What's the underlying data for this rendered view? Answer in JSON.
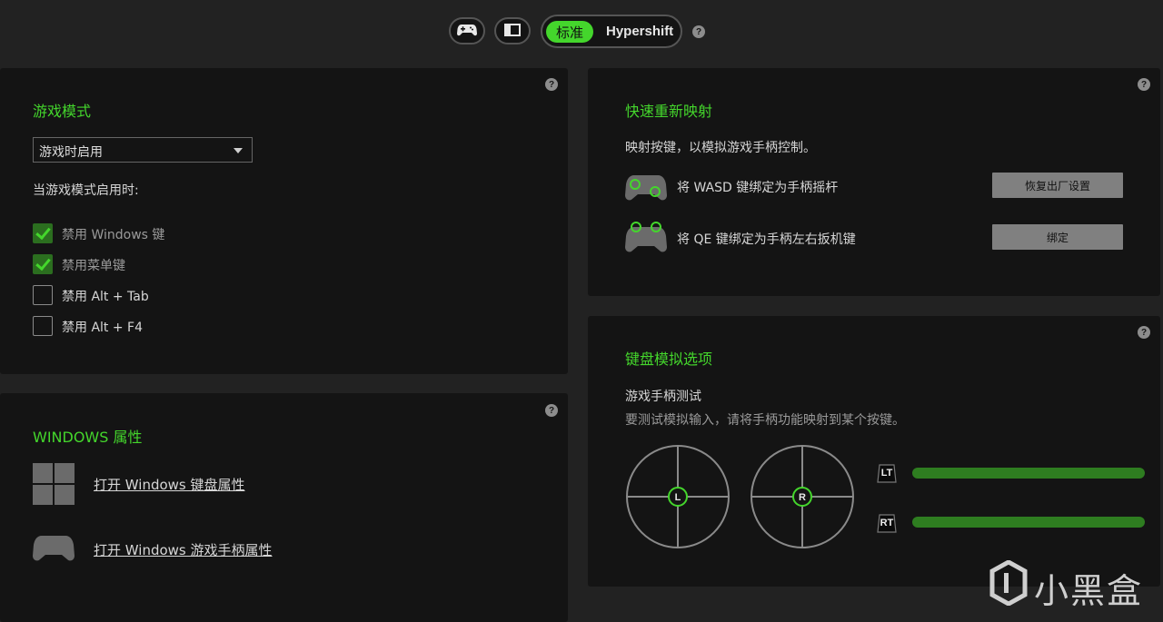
{
  "topbar": {
    "gamepad_icon": "gamepad-icon",
    "panel_icon": "sidebar-panel-icon",
    "mode_standard": "标准",
    "mode_hypershift": "Hypershift",
    "help": "?"
  },
  "game_mode": {
    "title": "游戏模式",
    "dropdown_value": "游戏时启用",
    "when_enabled": "当游戏模式启用时:",
    "options": [
      {
        "label": "禁用 Windows 键",
        "checked": true
      },
      {
        "label": "禁用菜单键",
        "checked": true
      },
      {
        "label": "禁用 Alt + Tab",
        "checked": false
      },
      {
        "label": "禁用 Alt + F4",
        "checked": false
      }
    ],
    "help": "?"
  },
  "windows_props": {
    "title": "WINDOWS 属性",
    "keyboard_link": "打开 Windows 键盘属性",
    "gamepad_link": "打开 Windows 游戏手柄属性",
    "help": "?"
  },
  "quick_remap": {
    "title": "快速重新映射",
    "description": "映射按键，以模拟游戏手柄控制。",
    "row1_text": "将 WASD 键绑定为手柄摇杆",
    "row1_button": "恢复出厂设置",
    "row2_text": "将 QE 键绑定为手柄左右扳机键",
    "row2_button": "绑定",
    "help": "?"
  },
  "keyboard_emulation": {
    "title": "键盘模拟选项",
    "test_title": "游戏手柄测试",
    "test_hint": "要测试模拟输入，请将手柄功能映射到某个按键。",
    "left_stick": "L",
    "right_stick": "R",
    "lt_label": "LT",
    "rt_label": "RT",
    "lt_level": 1.0,
    "rt_level": 1.0,
    "help": "?"
  },
  "watermark": {
    "text": "小黑盒"
  },
  "colors": {
    "accent": "#44d62c",
    "panel": "#141414",
    "background": "#222222"
  }
}
